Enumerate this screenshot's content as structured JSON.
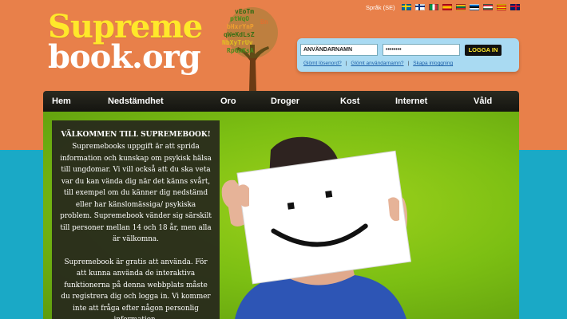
{
  "language": {
    "label": "Språk (SE)",
    "flags": [
      "swedish-flag",
      "finnish-flag",
      "italian-flag",
      "spanish-flag",
      "lithuanian-flag",
      "estonian-flag",
      "hungarian-flag",
      "catalan-flag",
      "british-flag"
    ]
  },
  "logo": {
    "line1": "Supreme",
    "line2": "book.org"
  },
  "login": {
    "username_value": "ANVÄNDARNAMN",
    "password_value": "••••••••",
    "button_label": "LOGGA IN",
    "forgot_password": "Glömt lösenord?",
    "forgot_username": "Glömt användarnamn?",
    "create_login": "Skapa inloggning",
    "separator": "|"
  },
  "nav": {
    "items": [
      "Hem",
      "Nedstämdhet",
      "Oro",
      "Droger",
      "Kost",
      "Internet",
      "Våld"
    ]
  },
  "welcome": {
    "title": "VÄLKOMMEN TILL SUPREMEBOOK!",
    "paragraph1": "Supremebooks uppgift är att sprida information och kunskap om psykisk hälsa till ungdomar. Vi vill också att du ska veta var du kan vända dig när det känns svårt, till exempel om du känner dig nedstämd eller har känslomässiga/ psykiska problem. Supremebook vänder sig särskilt till personer mellan 14 och 18 år, men alla är välkomna.",
    "paragraph2": "Supremebook är gratis att använda. För att kunna använda de interaktiva funktionerna på denna webbplats måste du registrera dig och logga in. Vi kommer inte att fråga efter någon personlig information."
  },
  "colors": {
    "orange_bg": "#e8804a",
    "teal_bg": "#1aa9c6",
    "logo_yellow": "#ffe82a",
    "hero_green": "#7cbf13",
    "nav_dark": "#1c1c16"
  }
}
